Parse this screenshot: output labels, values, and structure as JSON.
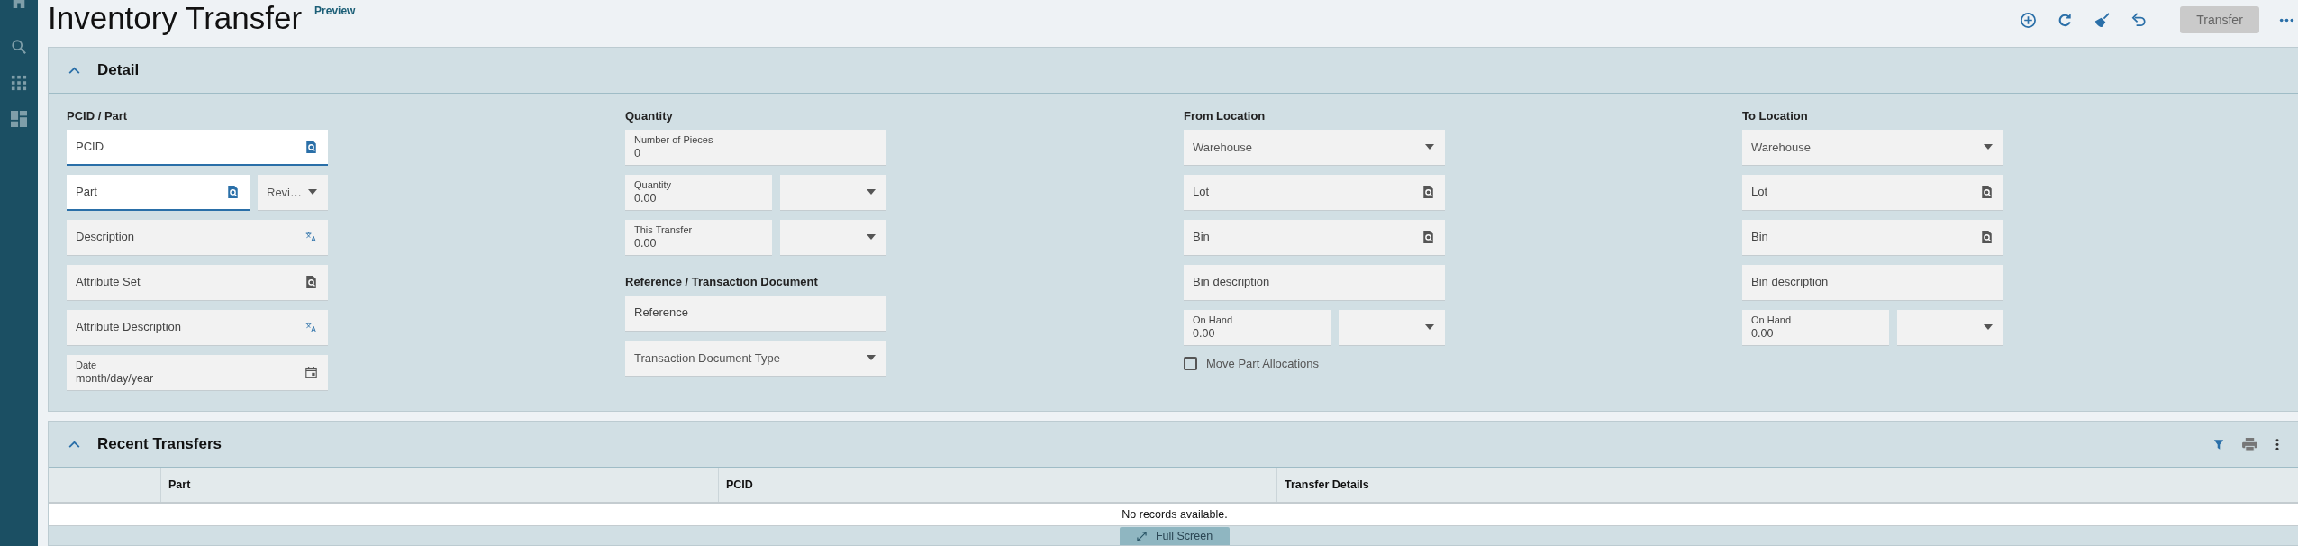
{
  "page": {
    "title": "Inventory Transfer",
    "badge": "Preview"
  },
  "toolbar": {
    "primary_button": {
      "label": "Transfer",
      "disabled": true
    }
  },
  "detail": {
    "title": "Detail",
    "expanded": true,
    "columns": [
      {
        "sections": [
          {
            "title": "PCID / Part",
            "rows": [
              [
                {
                  "kind": "lookup",
                  "placeholder": "PCID",
                  "disabled": false
                }
              ],
              [
                {
                  "kind": "lookup",
                  "placeholder": "Part",
                  "disabled": false
                },
                {
                  "kind": "select",
                  "placeholder": "Revi…",
                  "disabled": true
                }
              ],
              [
                {
                  "kind": "translatable",
                  "placeholder": "Description",
                  "disabled": true
                }
              ],
              [
                {
                  "kind": "lookup",
                  "placeholder": "Attribute Set",
                  "disabled": true
                }
              ],
              [
                {
                  "kind": "translatable",
                  "placeholder": "Attribute Description",
                  "disabled": true
                }
              ],
              [
                {
                  "kind": "date",
                  "label": "Date",
                  "placeholder": "month/day/year",
                  "disabled": true
                }
              ]
            ]
          }
        ]
      },
      {
        "sections": [
          {
            "title": "Quantity",
            "rows": [
              [
                {
                  "kind": "number",
                  "label": "Number of Pieces",
                  "value": "0",
                  "disabled": true
                }
              ],
              [
                {
                  "kind": "number",
                  "label": "Quantity",
                  "value": "0.00",
                  "disabled": true
                },
                {
                  "kind": "select",
                  "disabled": true
                }
              ],
              [
                {
                  "kind": "number",
                  "label": "This Transfer",
                  "value": "0.00",
                  "disabled": true
                },
                {
                  "kind": "select",
                  "disabled": true
                }
              ]
            ]
          },
          {
            "title": "Reference / Transaction Document",
            "rows": [
              [
                {
                  "kind": "text",
                  "placeholder": "Reference",
                  "disabled": true
                }
              ],
              [
                {
                  "kind": "select",
                  "placeholder": "Transaction Document Type",
                  "disabled": true
                }
              ]
            ]
          }
        ]
      },
      {
        "sections": [
          {
            "title": "From Location",
            "rows": [
              [
                {
                  "kind": "select",
                  "placeholder": "Warehouse",
                  "disabled": true
                }
              ],
              [
                {
                  "kind": "lookup",
                  "placeholder": "Lot",
                  "disabled": true
                }
              ],
              [
                {
                  "kind": "lookup",
                  "placeholder": "Bin",
                  "disabled": true
                }
              ],
              [
                {
                  "kind": "text",
                  "placeholder": "Bin description",
                  "disabled": true
                }
              ],
              [
                {
                  "kind": "number",
                  "label": "On Hand",
                  "value": "0.00",
                  "disabled": true
                },
                {
                  "kind": "select",
                  "disabled": true
                }
              ],
              [
                {
                  "kind": "checkbox",
                  "label": "Move Part Allocations",
                  "checked": false
                }
              ]
            ]
          }
        ]
      },
      {
        "sections": [
          {
            "title": "To Location",
            "rows": [
              [
                {
                  "kind": "select",
                  "placeholder": "Warehouse",
                  "disabled": true
                }
              ],
              [
                {
                  "kind": "lookup",
                  "placeholder": "Lot",
                  "disabled": true
                }
              ],
              [
                {
                  "kind": "lookup",
                  "placeholder": "Bin",
                  "disabled": true
                }
              ],
              [
                {
                  "kind": "text",
                  "placeholder": "Bin description",
                  "disabled": true
                }
              ],
              [
                {
                  "kind": "number",
                  "label": "On Hand",
                  "value": "0.00",
                  "disabled": true
                },
                {
                  "kind": "select",
                  "disabled": true
                }
              ]
            ]
          }
        ]
      }
    ]
  },
  "recent": {
    "title": "Recent Transfers",
    "expanded": true,
    "table": {
      "columns": [
        "Part",
        "PCID",
        "Transfer Details"
      ],
      "empty_message": "No records available."
    },
    "full_screen_button": "Full Screen"
  }
}
